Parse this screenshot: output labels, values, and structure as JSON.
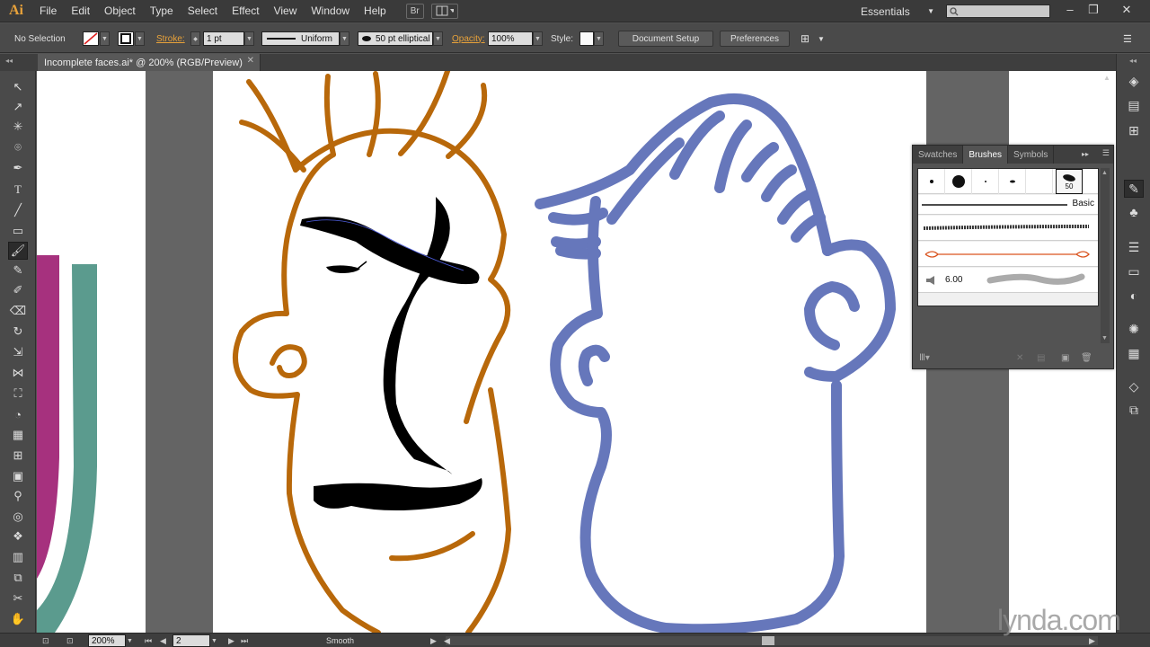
{
  "app": {
    "logo": "Ai"
  },
  "menu": [
    "File",
    "Edit",
    "Object",
    "Type",
    "Select",
    "Effect",
    "View",
    "Window",
    "Help"
  ],
  "menubar": {
    "bridge_label": "Br",
    "workspace": "Essentials"
  },
  "controlbar": {
    "selection": "No Selection",
    "stroke_label": "Stroke:",
    "stroke_weight": "1 pt",
    "profile": "Uniform",
    "brush": "50 pt elliptical",
    "opacity_label": "Opacity:",
    "opacity": "100%",
    "style_label": "Style:",
    "document_setup": "Document Setup",
    "preferences": "Preferences"
  },
  "document": {
    "tab_title": "Incomplete faces.ai* @ 200% (RGB/Preview)"
  },
  "brushes_panel": {
    "tabs": [
      "Swatches",
      "Brushes",
      "Symbols"
    ],
    "active_tab": "Brushes",
    "selected_brush_size": "50",
    "basic_label": "Basic",
    "bristle_value": "6.00"
  },
  "statusbar": {
    "zoom": "200%",
    "artboard": "2",
    "tool": "Smooth"
  },
  "watermark": "lynda.com",
  "colors": {
    "orange_face": "#b8680a",
    "blue_face": "#6677bb",
    "magenta": "#a6317e",
    "teal": "#5b9b8e"
  }
}
